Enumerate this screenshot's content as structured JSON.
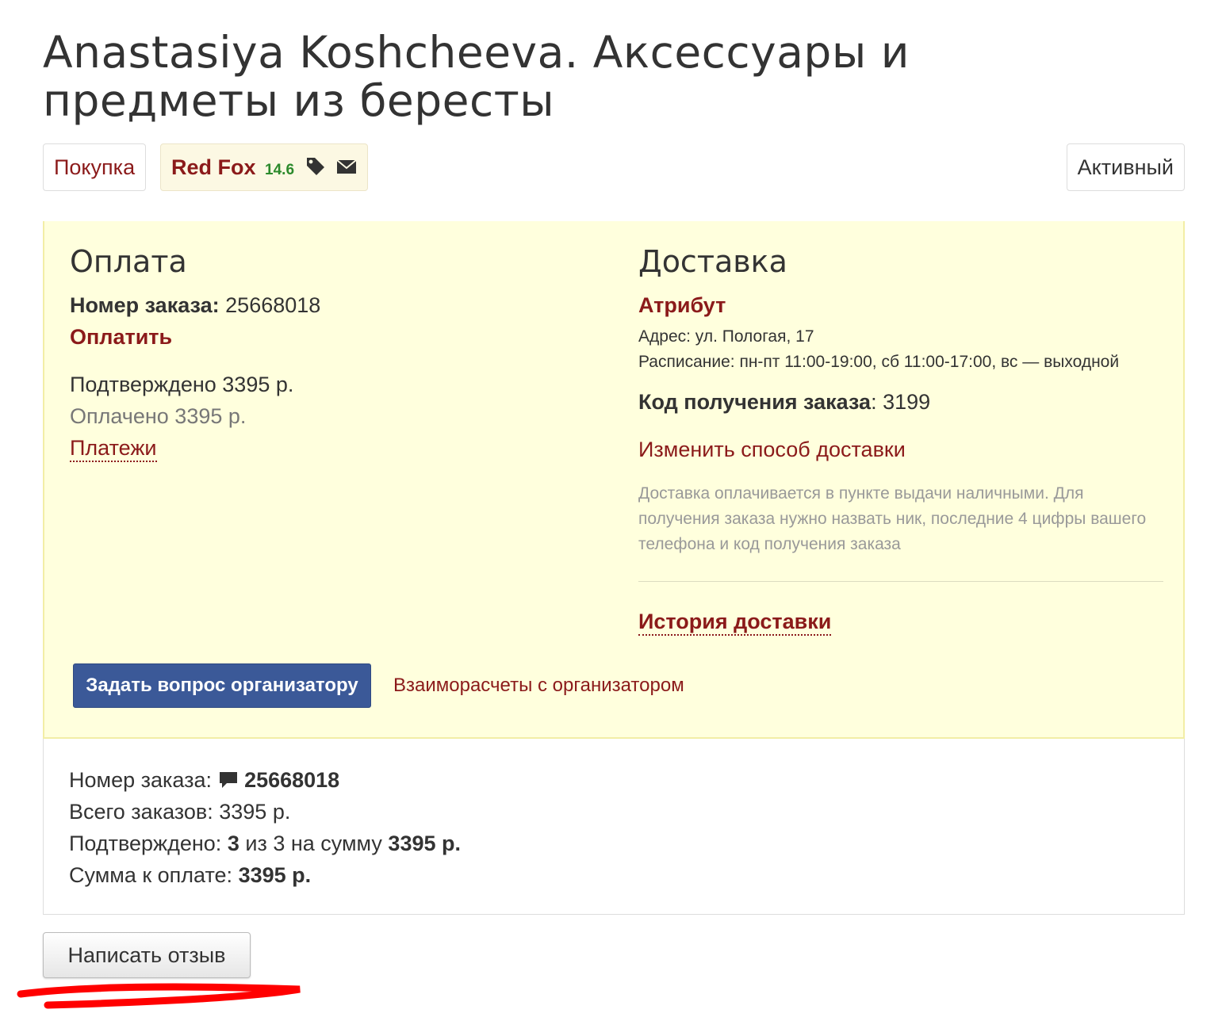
{
  "page": {
    "title": "Anastasiya Koshcheeva. Аксессуары и предметы из бересты"
  },
  "pills": {
    "purchase": "Покупка",
    "organizer_name": "Red Fox",
    "organizer_rating": "14.6",
    "organizer_icons": [
      "tag-icon",
      "envelope-icon"
    ],
    "status": "Активный"
  },
  "payment": {
    "heading": "Оплата",
    "order_label": "Номер заказа:",
    "order_number": "25668018",
    "pay_link": "Оплатить",
    "confirmed": "Подтверждено 3395 р.",
    "paid": "Оплачено 3395 р.",
    "payments_link": "Платежи"
  },
  "delivery": {
    "heading": "Доставка",
    "point_name": "Атрибут",
    "address": "Адрес: ул. Пологая, 17",
    "schedule": "Расписание: пн-пт 11:00-19:00, сб 11:00-17:00, вс — выходной",
    "pickup_code_label": "Код получения заказа",
    "pickup_code": ": 3199",
    "change_link": "Изменить способ доставки",
    "note": "Доставка оплачивается в пункте выдачи наличными. Для получения заказа нужно назвать ник, последние 4 цифры вашего телефона и код получения заказа",
    "history_link": "История доставки"
  },
  "actions": {
    "ask_button": "Задать вопрос организатору",
    "mutual_link": "Взаиморасчеты с организатором"
  },
  "summary": {
    "order_label": "Номер заказа:",
    "order_number": "25668018",
    "total_label": "Всего заказов: 3395 р.",
    "confirmed_label": "Подтверждено:",
    "confirmed_count": "3",
    "confirmed_of": "из 3 на сумму",
    "confirmed_sum": "3395 р.",
    "due_label": "Сумма к оплате:",
    "due_sum": "3395 р."
  },
  "review": {
    "button": "Написать отзыв"
  },
  "colors": {
    "accent_red": "#8b1a1a",
    "panel_bg": "#ffffdd",
    "button_blue": "#3b5998",
    "rating_green": "#2c8a2c",
    "annotation_red": "#ff0000"
  }
}
